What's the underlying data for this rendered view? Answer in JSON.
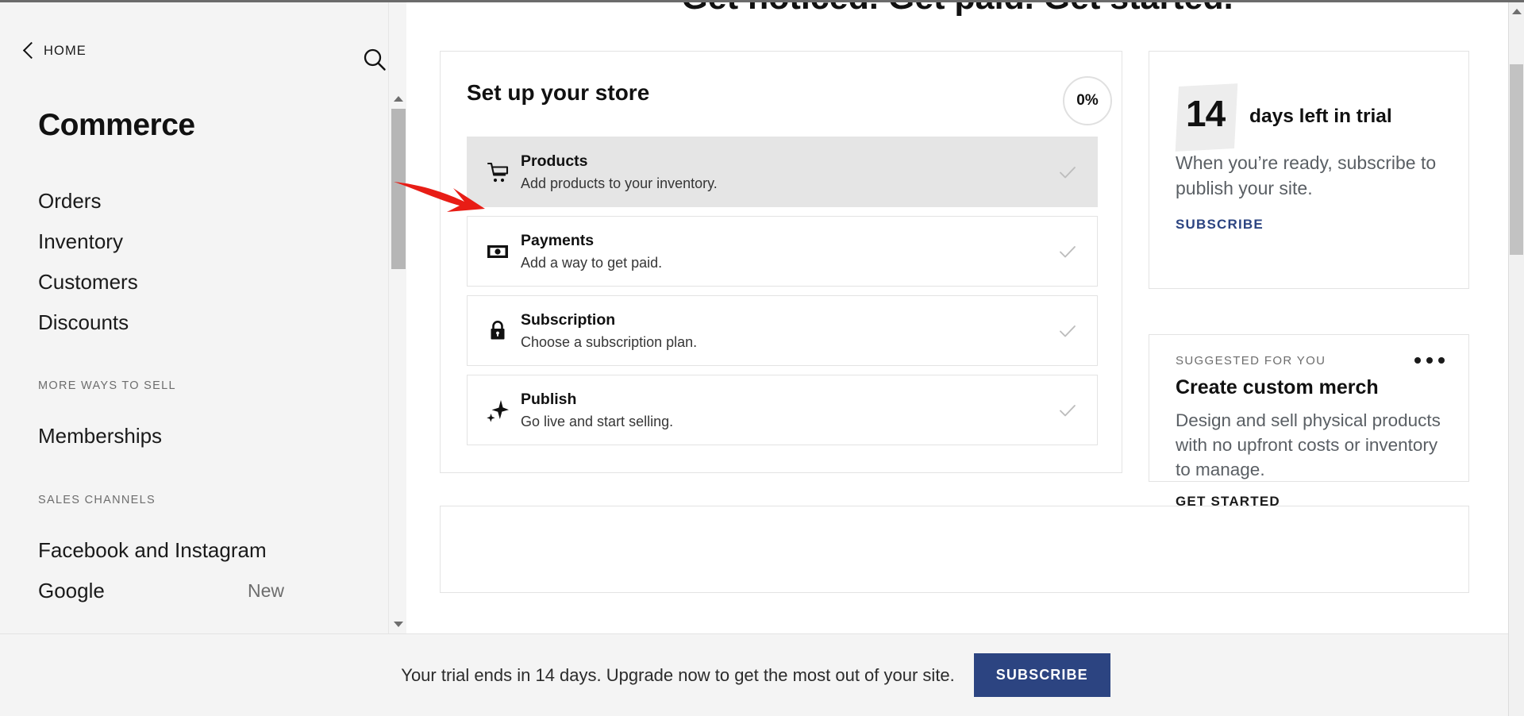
{
  "sidebar": {
    "back_label": "HOME",
    "back_icon": "chevron-left-icon",
    "search_icon": "search-icon",
    "title": "Commerce",
    "items": [
      {
        "label": "Orders"
      },
      {
        "label": "Inventory"
      },
      {
        "label": "Customers"
      },
      {
        "label": "Discounts"
      }
    ],
    "section_more_ways": "MORE WAYS TO SELL",
    "more_ways_items": [
      {
        "label": "Memberships"
      }
    ],
    "section_sales_channels": "SALES CHANNELS",
    "sales_channel_items": [
      {
        "label": "Facebook and Instagram",
        "badge": ""
      },
      {
        "label": "Google",
        "badge": "New"
      }
    ]
  },
  "main": {
    "clipped_heading": "Get noticed. Get paid. Get started.",
    "setup": {
      "title": "Set up your store",
      "progress": "0%",
      "tasks": [
        {
          "icon": "shopping-cart-icon",
          "name": "Products",
          "desc": "Add products to your inventory.",
          "check_icon": "check-icon",
          "active": true
        },
        {
          "icon": "payments-icon",
          "name": "Payments",
          "desc": "Add a way to get paid.",
          "check_icon": "check-icon",
          "active": false
        },
        {
          "icon": "lock-icon",
          "name": "Subscription",
          "desc": "Choose a subscription plan.",
          "check_icon": "check-icon",
          "active": false
        },
        {
          "icon": "sparkle-icon",
          "name": "Publish",
          "desc": "Go live and start selling.",
          "check_icon": "check-icon",
          "active": false
        }
      ]
    },
    "trial_card": {
      "days": "14",
      "days_label": "days left in trial",
      "body": "When you’re ready, subscribe to publish your site.",
      "cta": "SUBSCRIBE"
    },
    "suggested_card": {
      "eyebrow": "SUGGESTED FOR YOU",
      "menu_icon": "ellipsis-icon",
      "title": "Create custom merch",
      "body": "Design and sell physical products with no upfront costs or inventory to manage.",
      "cta": "GET STARTED"
    },
    "annotation": {
      "arrow_icon": "red-arrow-annotation",
      "color": "#e81d16"
    }
  },
  "bottom_bar": {
    "message": "Your trial ends in 14 days. Upgrade now to get the most out of your site.",
    "button_label": "SUBSCRIBE",
    "button_color": "#2c4481"
  },
  "scrollbars": {
    "sidebar_up_icon": "triangle-up-icon",
    "sidebar_down_icon": "triangle-down-icon",
    "browser_up_icon": "triangle-up-icon"
  }
}
